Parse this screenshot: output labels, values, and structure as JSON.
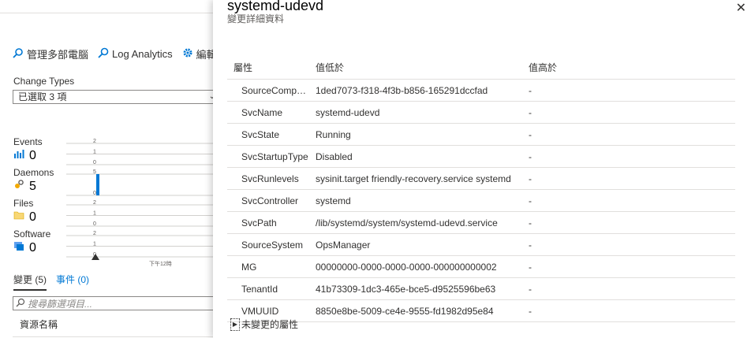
{
  "toolbar": {
    "manage_label": "管理多部電腦",
    "log_label": "Log Analytics",
    "edit_label": "編輯"
  },
  "filters": {
    "change_types_label": "Change Types",
    "change_types_value": "已選取 3 項"
  },
  "metrics": [
    {
      "label": "Events",
      "value": "0",
      "icon": "events-chart-icon"
    },
    {
      "label": "Daemons",
      "value": "5",
      "icon": "daemons-gear-icon"
    },
    {
      "label": "Files",
      "value": "0",
      "icon": "folder-icon"
    },
    {
      "label": "Software",
      "value": "0",
      "icon": "software-window-icon"
    }
  ],
  "chart_data": {
    "type": "bar",
    "title": "",
    "xlabel": "下午12時",
    "series": [
      {
        "name": "Events",
        "yticks": [
          "2",
          "1",
          "0"
        ],
        "values": [
          0
        ]
      },
      {
        "name": "Daemons",
        "yticks": [
          "5",
          "0"
        ],
        "values": [
          5
        ]
      },
      {
        "name": "Files",
        "yticks": [
          "2",
          "1",
          "0"
        ],
        "values": [
          0
        ]
      },
      {
        "name": "Software",
        "yticks": [
          "2",
          "1",
          "0"
        ],
        "values": [
          0
        ]
      }
    ]
  },
  "tabs": [
    {
      "label": "變更 (5)",
      "active": true
    },
    {
      "label": "事件 (0)",
      "active": false
    }
  ],
  "search": {
    "placeholder": "搜尋篩選項目..."
  },
  "resource_column": "資源名稱",
  "panel": {
    "title": "systemd-udevd",
    "subtitle": "變更詳細資料",
    "close_glyph": "✕",
    "headers": {
      "property": "屬性",
      "old": "值低於",
      "new": "值高於"
    },
    "rows": [
      {
        "property": "SourceComputerId",
        "old": "1ded7073-f318-4f3b-b856-165291dccfad",
        "new": "-"
      },
      {
        "property": "SvcName",
        "old": "systemd-udevd",
        "new": "-"
      },
      {
        "property": "SvcState",
        "old": "Running",
        "new": "-"
      },
      {
        "property": "SvcStartupType",
        "old": "Disabled",
        "new": "-"
      },
      {
        "property": "SvcRunlevels",
        "old": "sysinit.target friendly-recovery.service systemd",
        "new": "-"
      },
      {
        "property": "SvcController",
        "old": "systemd",
        "new": "-"
      },
      {
        "property": "SvcPath",
        "old": "/lib/systemd/system/systemd-udevd.service",
        "new": "-"
      },
      {
        "property": "SourceSystem",
        "old": "OpsManager",
        "new": "-"
      },
      {
        "property": "MG",
        "old": "00000000-0000-0000-0000-000000000002",
        "new": "-"
      },
      {
        "property": "TenantId",
        "old": "41b73309-1dc3-465e-bce5-d9525596be63",
        "new": "-"
      },
      {
        "property": "VMUUID",
        "old": "8850e8be-5009-ce4e-9555-fd1982d95e84",
        "new": "-"
      }
    ],
    "unchanged_label": "未變更的屬性"
  }
}
